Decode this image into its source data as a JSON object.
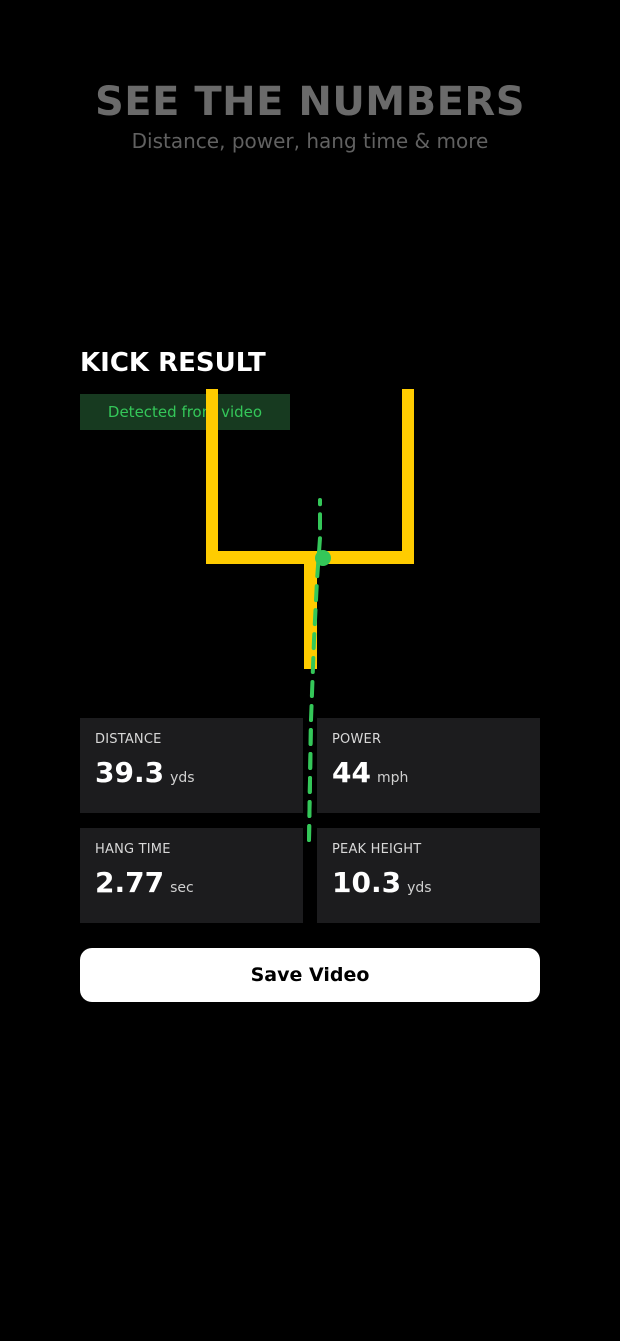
{
  "hero": {
    "title": "SEE THE NUMBERS",
    "subtitle": "Distance, power, hang time & more"
  },
  "kick_result": {
    "title": "KICK RESULT",
    "badge": "Detected from video"
  },
  "stats": [
    {
      "label": "DISTANCE",
      "value": "39.3",
      "unit": "yds"
    },
    {
      "label": "POWER",
      "value": "44",
      "unit": "mph"
    },
    {
      "label": "HANG TIME",
      "value": "2.77",
      "unit": "sec"
    },
    {
      "label": "PEAK HEIGHT",
      "value": "10.3",
      "unit": "yds"
    }
  ],
  "actions": {
    "save_label": "Save Video"
  },
  "colors": {
    "goal_post": "#ffcc00",
    "trajectory": "#34c759",
    "badge_bg": "#173a20",
    "card_bg": "#1c1c1e"
  }
}
